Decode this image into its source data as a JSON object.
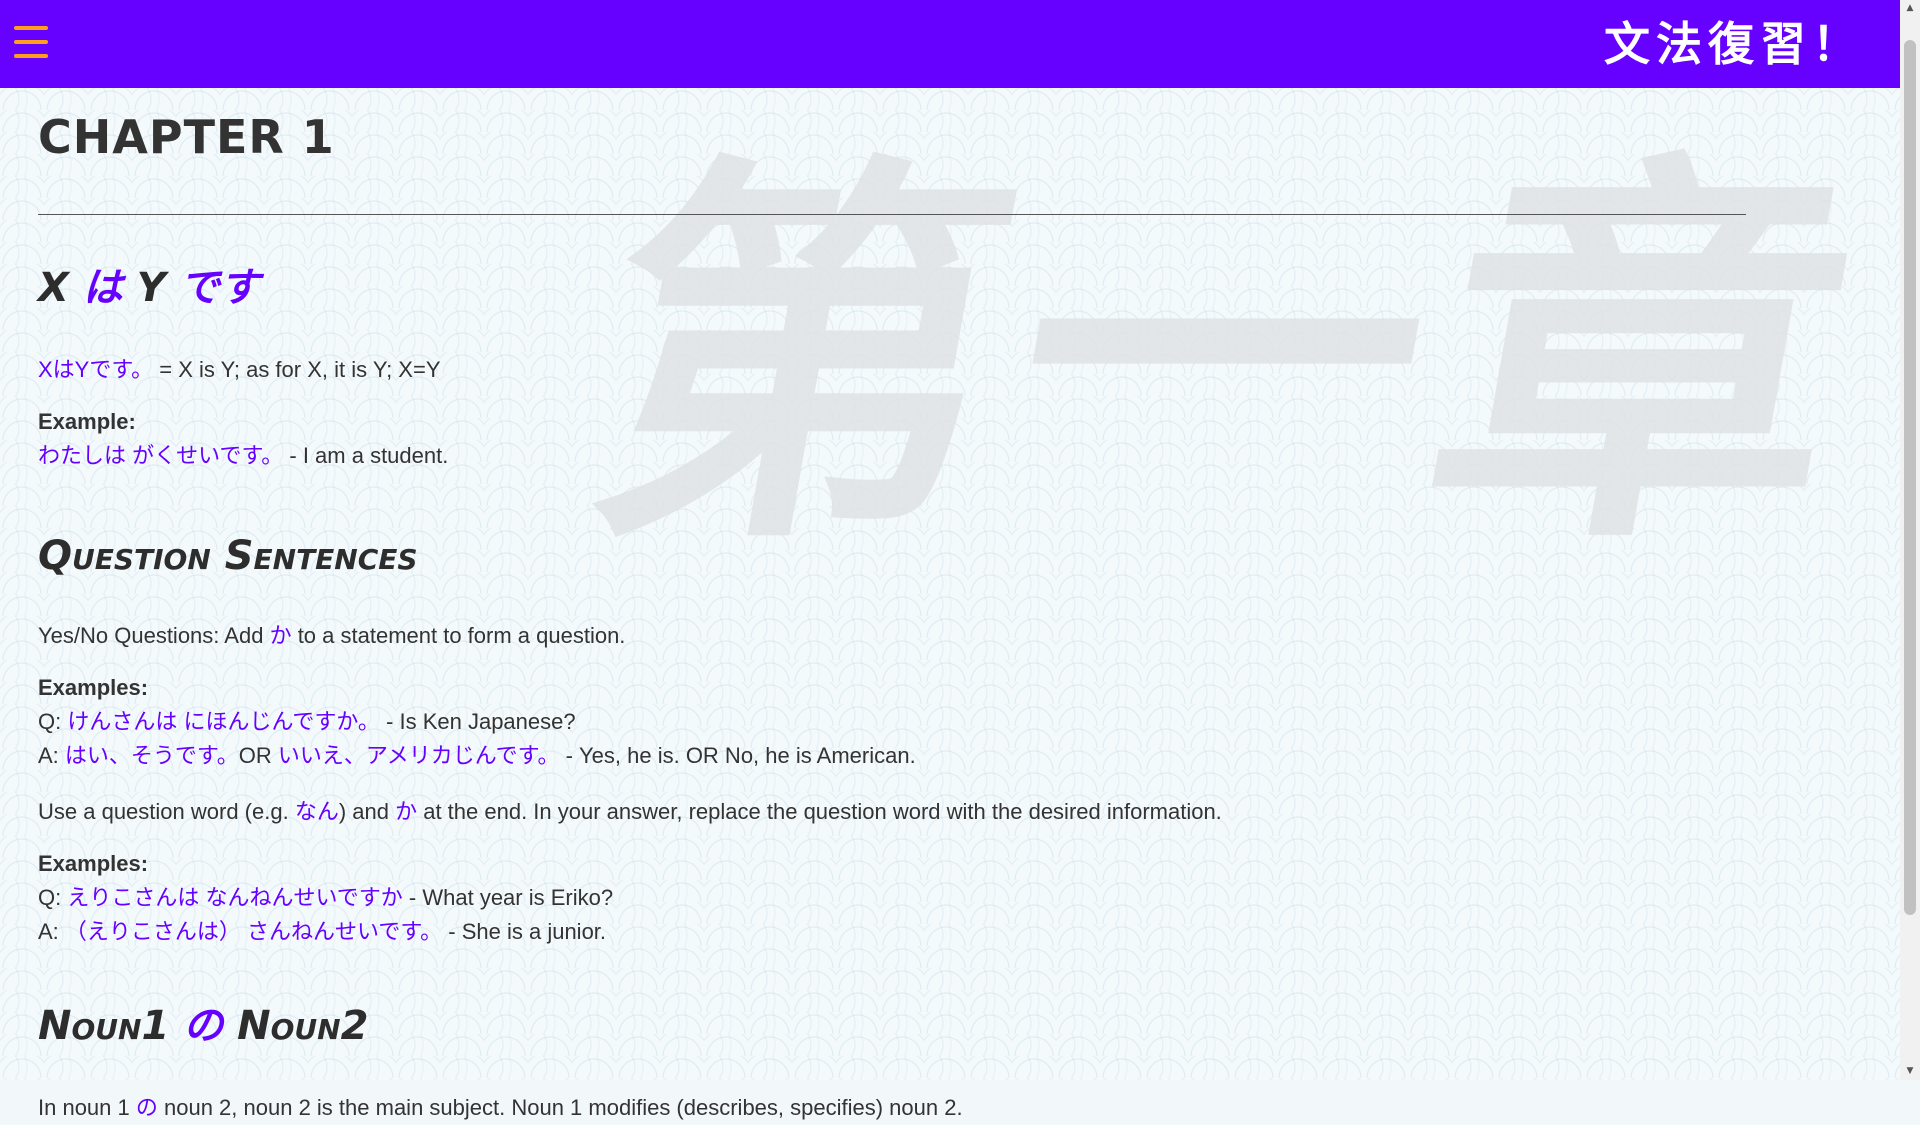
{
  "header": {
    "site_title": "文法復習！",
    "menu_icon": "hamburger-icon"
  },
  "watermark": "第一章",
  "colors": {
    "accent": "#6600ff",
    "menu": "#ff9e1b",
    "text": "#333333"
  },
  "chapter_title": "CHAPTER 1",
  "section1": {
    "heading_x": "X ",
    "heading_wa": "は",
    "heading_y": " Y ",
    "heading_desu": "です",
    "def_jp": "XはYです。",
    "def_en": " = X is Y; as for X, it is Y; X=Y",
    "example_label": "Example:",
    "example_jp": "わたしは がくせいです。",
    "example_en": " - I am a student."
  },
  "section2": {
    "heading": "Question Sentences",
    "intro_pre": "Yes/No Questions: Add ",
    "intro_ka": "か",
    "intro_post": " to a statement to form a question.",
    "examples_label": "Examples:",
    "q_prefix": "Q: ",
    "q_jp": "けんさんは にほんじんですか。",
    "q_en": " - Is Ken Japanese?",
    "a_prefix": "A: ",
    "a_jp1": "はい、そうです。",
    "a_or": "OR ",
    "a_jp2": "いいえ、アメリカじんです。",
    "a_en": " - Yes, he is. OR No, he is American.",
    "qw_pre": "Use a question word (e.g. ",
    "qw_nan": "なん",
    "qw_mid": ") and ",
    "qw_ka": "か",
    "qw_post": " at the end. In your answer, replace the question word with the desired information.",
    "examples2_label": "Examples:",
    "q2_prefix": "Q: ",
    "q2_jp": "えりこさんは なんねんせいですか",
    "q2_en": " - What year is Eriko?",
    "a2_prefix": "A: ",
    "a2_jp": "（えりこさんは） さんねんせいです。",
    "a2_en": " - She is a junior."
  },
  "section3": {
    "heading_n1": "Noun1 ",
    "heading_no": "の",
    "heading_n2": " Noun2",
    "desc_pre": "In noun 1 ",
    "desc_no": "の",
    "desc_post": " noun 2, noun 2 is the main subject. Noun 1 modifies (describes, specifies) noun 2."
  },
  "scrollbar": {
    "up_icon": "▲",
    "down_icon": "▼"
  }
}
